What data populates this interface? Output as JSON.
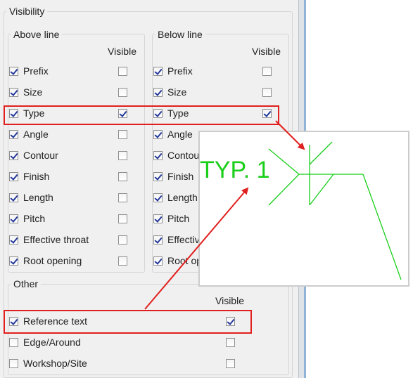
{
  "visibility": {
    "title": "Visibility"
  },
  "above": {
    "title": "Above line",
    "visible_header": "Visible",
    "items": [
      {
        "label": "Prefix",
        "checked": true,
        "visible": false
      },
      {
        "label": "Size",
        "checked": true,
        "visible": false
      },
      {
        "label": "Type",
        "checked": true,
        "visible": true
      },
      {
        "label": "Angle",
        "checked": true,
        "visible": false
      },
      {
        "label": "Contour",
        "checked": true,
        "visible": false
      },
      {
        "label": "Finish",
        "checked": true,
        "visible": false
      },
      {
        "label": "Length",
        "checked": true,
        "visible": false
      },
      {
        "label": "Pitch",
        "checked": true,
        "visible": false
      },
      {
        "label": "Effective throat",
        "checked": true,
        "visible": false
      },
      {
        "label": "Root opening",
        "checked": true,
        "visible": false
      }
    ]
  },
  "below": {
    "title": "Below line",
    "visible_header": "Visible",
    "items": [
      {
        "label": "Prefix",
        "checked": true,
        "visible": false
      },
      {
        "label": "Size",
        "checked": true,
        "visible": false
      },
      {
        "label": "Type",
        "checked": true,
        "visible": true
      },
      {
        "label": "Angle",
        "checked": true
      },
      {
        "label": "Contour",
        "checked": true
      },
      {
        "label": "Finish",
        "checked": true
      },
      {
        "label": "Length",
        "checked": true
      },
      {
        "label": "Pitch",
        "checked": true
      },
      {
        "label": "Effective throat",
        "checked": true
      },
      {
        "label": "Root opening",
        "checked": true
      }
    ]
  },
  "other": {
    "title": "Other",
    "visible_header": "Visible",
    "items": [
      {
        "label": "Reference text",
        "checked": true,
        "visible": true
      },
      {
        "label": "Edge/Around",
        "checked": false,
        "visible": false
      },
      {
        "label": "Workshop/Site",
        "checked": false,
        "visible": false
      }
    ]
  },
  "preview": {
    "text": "TYP. 1"
  },
  "colors": {
    "highlight": "#e0201e",
    "weld_line": "#19cf19",
    "check": "#23389a"
  }
}
